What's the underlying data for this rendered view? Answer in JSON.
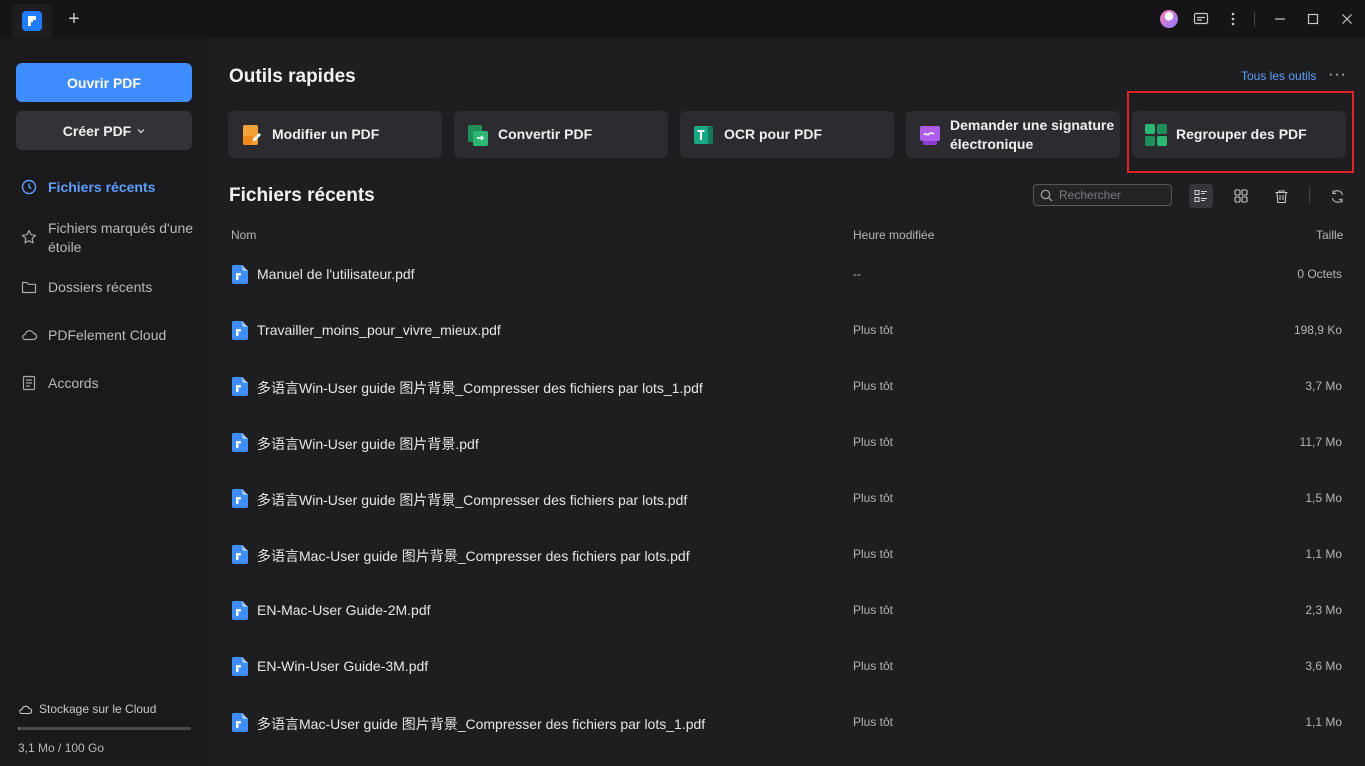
{
  "titlebar": {
    "new_tab": "+",
    "icons": [
      "app-logo-icon",
      "plus-icon",
      "avatar",
      "message-icon",
      "more-vertical-icon",
      "minimize-icon",
      "maximize-icon",
      "close-icon"
    ]
  },
  "sidebar": {
    "open_pdf": "Ouvrir PDF",
    "create_pdf": "Créer PDF",
    "items": [
      {
        "label": "Fichiers récents",
        "icon": "clock-icon",
        "active": true
      },
      {
        "label": "Fichiers marqués d'une étoile",
        "icon": "star-icon",
        "active": false
      },
      {
        "label": "Dossiers récents",
        "icon": "folder-icon",
        "active": false
      },
      {
        "label": "PDFelement Cloud",
        "icon": "cloud-icon",
        "active": false
      },
      {
        "label": "Accords",
        "icon": "document-icon",
        "active": false
      }
    ],
    "cloud": {
      "label": "Stockage sur le Cloud",
      "usage": "3,1 Mo / 100 Go",
      "used_fraction": 3e-05
    }
  },
  "quick_tools": {
    "title": "Outils rapides",
    "all_tools": "Tous les outils",
    "more": "···",
    "tools": [
      {
        "label": "Modifier un PDF",
        "icon": "edit-pdf-icon",
        "color": "#f5a13a"
      },
      {
        "label": "Convertir PDF",
        "icon": "convert-pdf-icon",
        "color": "#2bb673"
      },
      {
        "label": "OCR pour PDF",
        "icon": "ocr-icon",
        "color": "#19a886"
      },
      {
        "label": "Demander une signature électronique",
        "icon": "esign-icon",
        "color": "#b05cf0"
      },
      {
        "label": "Regrouper des PDF",
        "icon": "combine-pdf-icon",
        "color": "#2bb673",
        "highlighted": true
      }
    ]
  },
  "recent": {
    "title": "Fichiers récents",
    "search_placeholder": "Rechercher",
    "columns": {
      "name": "Nom",
      "modified": "Heure modifiée",
      "size": "Taille"
    },
    "files": [
      {
        "name": "Manuel de l'utilisateur.pdf",
        "modified": "--",
        "size": "0 Octets"
      },
      {
        "name": "Travailler_moins_pour_vivre_mieux.pdf",
        "modified": "Plus tôt",
        "size": "198,9 Ko"
      },
      {
        "name": "多语言Win-User guide 图片背景_Compresser des fichiers par lots_1.pdf",
        "modified": "Plus tôt",
        "size": "3,7 Mo"
      },
      {
        "name": "多语言Win-User guide 图片背景.pdf",
        "modified": "Plus tôt",
        "size": "11,7 Mo"
      },
      {
        "name": "多语言Win-User guide 图片背景_Compresser des fichiers par lots.pdf",
        "modified": "Plus tôt",
        "size": "1,5 Mo"
      },
      {
        "name": "多语言Mac-User guide 图片背景_Compresser des fichiers par lots.pdf",
        "modified": "Plus tôt",
        "size": "1,1 Mo"
      },
      {
        "name": "EN-Mac-User Guide-2M.pdf",
        "modified": "Plus tôt",
        "size": "2,3 Mo"
      },
      {
        "name": "EN-Win-User Guide-3M.pdf",
        "modified": "Plus tôt",
        "size": "3,6 Mo"
      },
      {
        "name": "多语言Mac-User guide 图片背景_Compresser des fichiers par lots_1.pdf",
        "modified": "Plus tôt",
        "size": "1,1 Mo"
      }
    ]
  },
  "colors": {
    "accent": "#3f8cff",
    "link": "#5e9eff",
    "highlight": "#e02424",
    "file_icon": "#3f8cff"
  }
}
